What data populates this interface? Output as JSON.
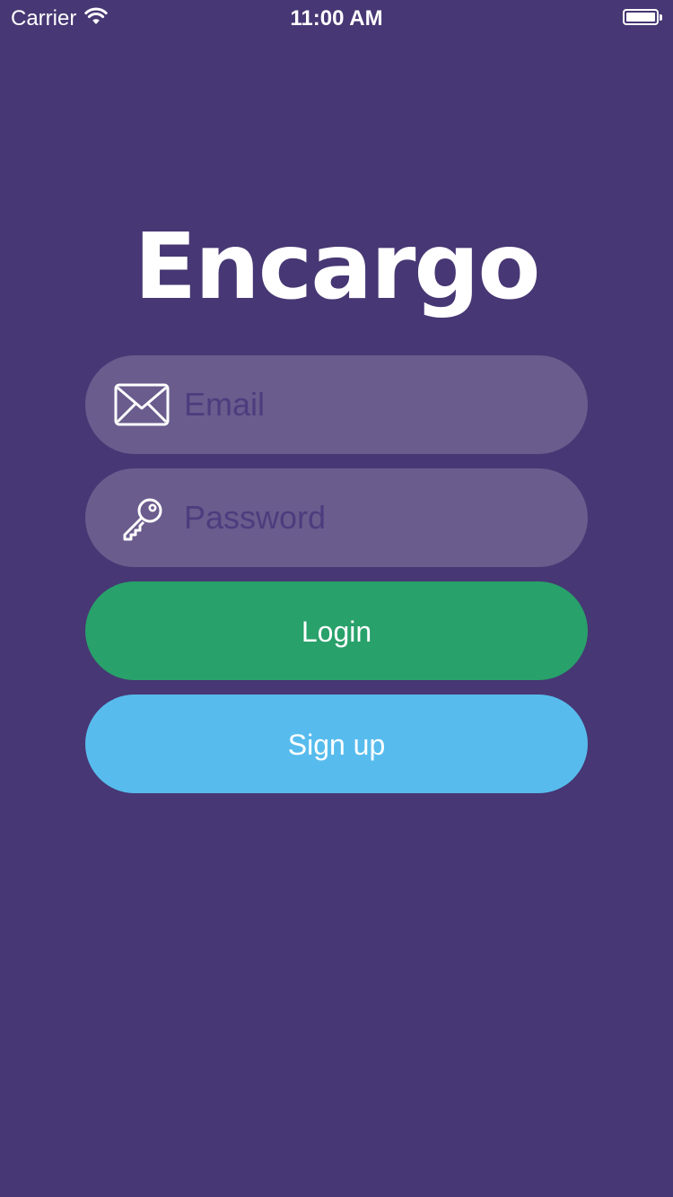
{
  "status_bar": {
    "carrier": "Carrier",
    "time": "11:00 AM",
    "icons": [
      "wifi-icon",
      "battery-icon"
    ]
  },
  "app": {
    "title": "Encargo"
  },
  "form": {
    "email_placeholder": "Email",
    "email_value": "",
    "email_icon": "envelope-icon",
    "password_placeholder": "Password",
    "password_value": "",
    "password_icon": "key-icon",
    "login_label": "Login",
    "signup_label": "Sign up"
  },
  "colors": {
    "background": "#473774",
    "field_background": "#6a5c8d",
    "placeholder": "#4d3c7e",
    "login_button": "#28a16a",
    "signup_button": "#57bced",
    "text": "#ffffff"
  }
}
